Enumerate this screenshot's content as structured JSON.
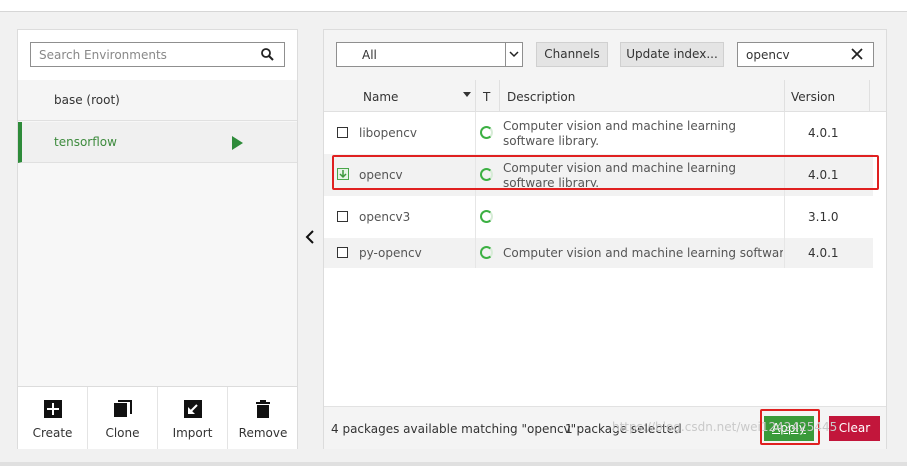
{
  "environments": {
    "search_placeholder": "Search Environments",
    "items": [
      {
        "label": "base (root)",
        "active": false
      },
      {
        "label": "tensorflow",
        "active": true
      }
    ],
    "actions": [
      {
        "label": "Create",
        "icon": "plus-square-icon"
      },
      {
        "label": "Clone",
        "icon": "clone-icon"
      },
      {
        "label": "Import",
        "icon": "import-arrow-icon"
      },
      {
        "label": "Remove",
        "icon": "trash-icon"
      }
    ]
  },
  "packages": {
    "filter_value": "All",
    "channels_label": "Channels",
    "update_index_label": "Update index...",
    "search_value": "opencv",
    "columns": {
      "name": "Name",
      "type": "T",
      "description": "Description",
      "version": "Version"
    },
    "rows": [
      {
        "name": "libopencv",
        "description": "Computer vision and machine learning software library.",
        "version": "4.0.1",
        "checkbox": "unchecked",
        "selected": false
      },
      {
        "name": "opencv",
        "description": "Computer vision and machine learning software library.",
        "version": "4.0.1",
        "checkbox": "marked-for-install",
        "selected": true
      },
      {
        "name": "opencv3",
        "description": "",
        "version": "3.1.0",
        "checkbox": "unchecked",
        "selected": false
      },
      {
        "name": "py-opencv",
        "description": "Computer vision and machine learning softwar…",
        "version": "4.0.1",
        "checkbox": "unchecked",
        "selected": false
      }
    ],
    "footer_status": "4 packages available matching \"opencv\"",
    "footer_selected": "1 package selected",
    "apply_label": "Apply",
    "clear_label": "Clear"
  },
  "watermark": "https://blog.csdn.net/wei1242425445",
  "colors": {
    "accent_green": "#2e8b3a",
    "apply_green": "#3a9a3a",
    "clear_red": "#c2163b",
    "highlight_red": "#e02020"
  }
}
